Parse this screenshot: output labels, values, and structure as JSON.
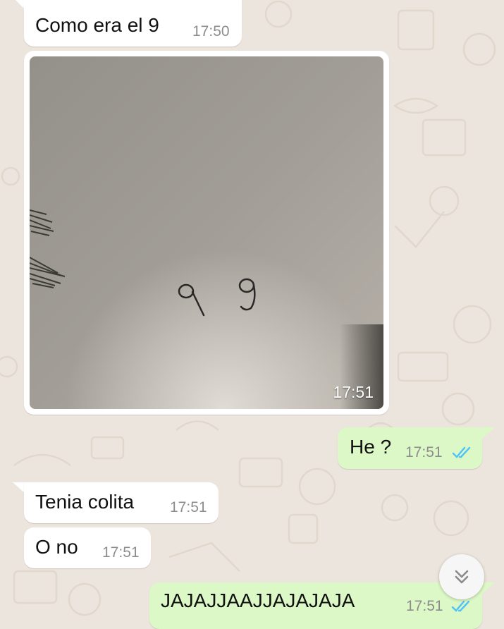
{
  "colors": {
    "background": "#ece5dd",
    "incoming_bubble": "#ffffff",
    "outgoing_bubble": "#dcf8c6",
    "read_ticks": "#4fc3f7"
  },
  "messages": [
    {
      "direction": "incoming",
      "text": "Como era el 9",
      "time": "17:50"
    },
    {
      "direction": "incoming",
      "type": "image",
      "caption_drawn": "9 9",
      "time": "17:51"
    },
    {
      "direction": "outgoing",
      "text": "He ?",
      "time": "17:51",
      "status": "read"
    },
    {
      "direction": "incoming",
      "text": "Tenia colita",
      "time": "17:51"
    },
    {
      "direction": "incoming",
      "text": "O no",
      "time": "17:51"
    },
    {
      "direction": "outgoing",
      "text": "JAJAJJAAJJAJAJAJA",
      "time": "17:51",
      "status": "read"
    }
  ],
  "scroll_button": {
    "icon": "double-chevron-down-icon"
  }
}
